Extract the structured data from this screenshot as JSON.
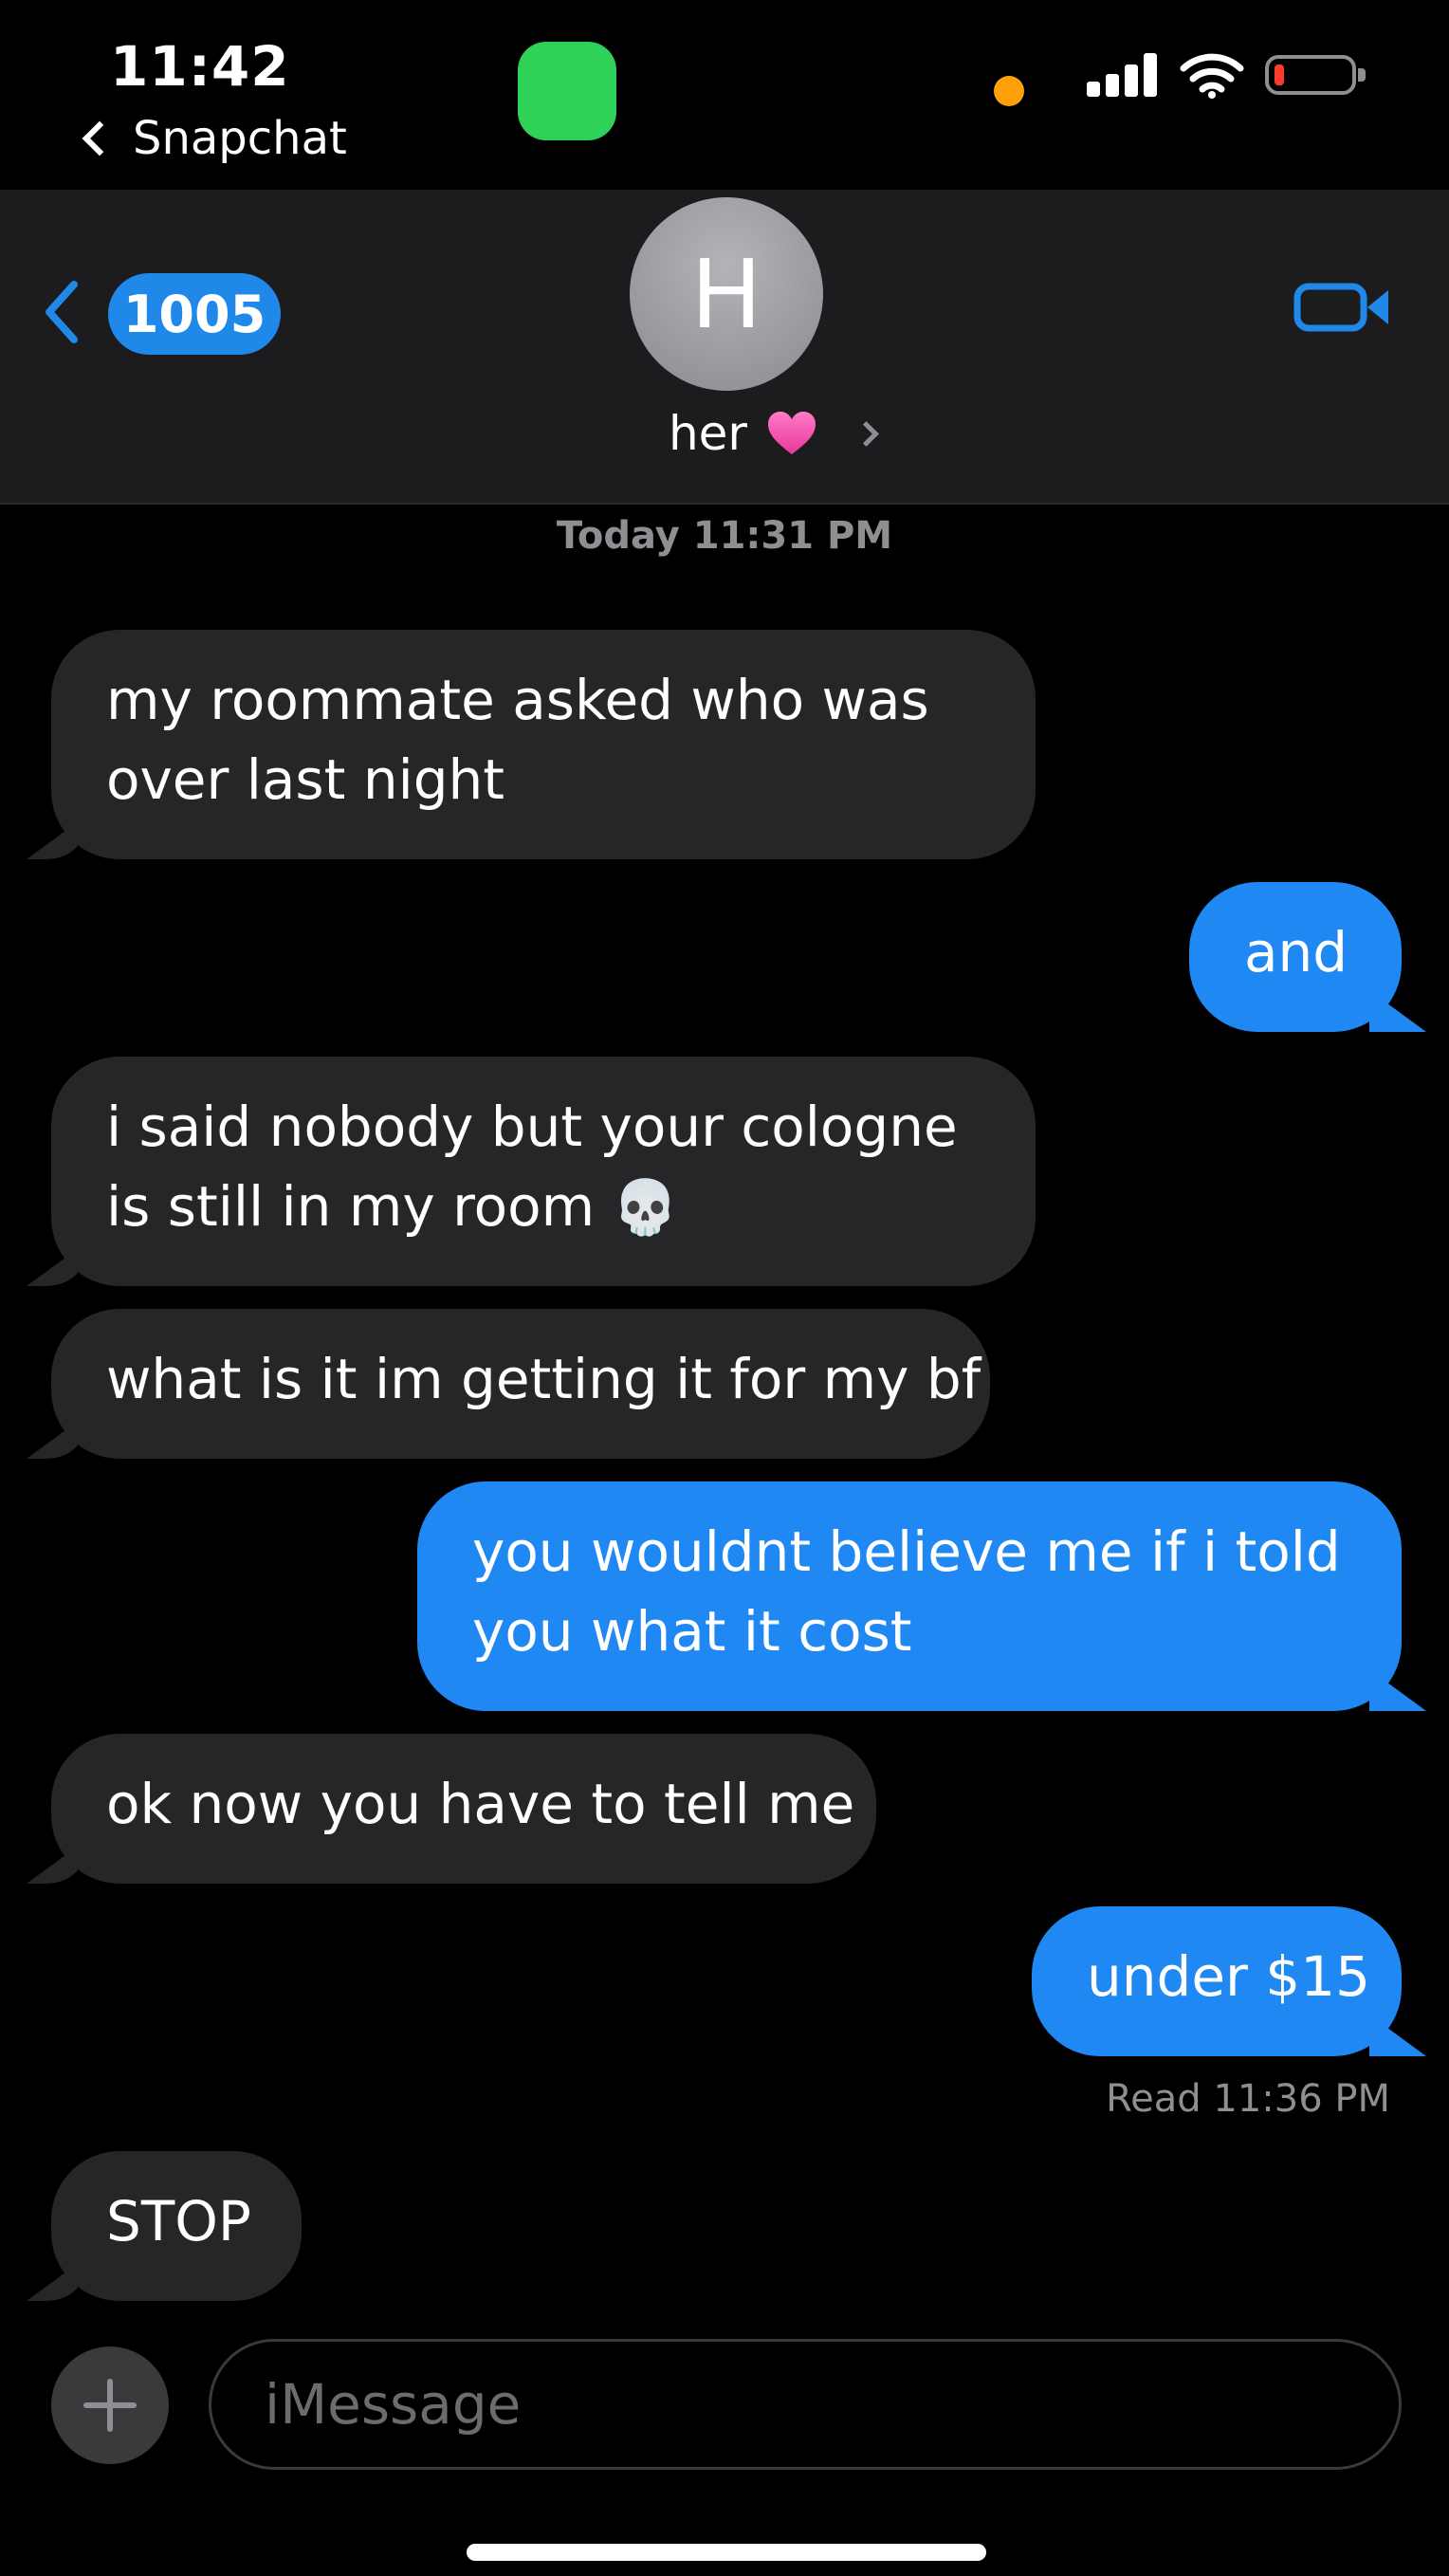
{
  "status_bar": {
    "time": "11:42",
    "back_app_label": "Snapchat",
    "signal_icon": "cellular-signal-icon",
    "wifi_icon": "wifi-icon",
    "battery_icon": "battery-low-icon",
    "recording_indicator_color": "#30d158",
    "mic_indicator_color": "#ff9f0a",
    "battery_color": "#ff3b30"
  },
  "header": {
    "unread_count": "1005",
    "avatar_initial": "H",
    "contact_name": "her",
    "contact_emoji": "pink-heart-icon",
    "video_call_icon": "facetime-video-icon",
    "accent_color": "#1f88e8"
  },
  "conversation": {
    "timestamp": "Today 11:31 PM",
    "messages": [
      {
        "direction": "incoming",
        "text_line1": "my roommate asked who was",
        "text_line2": "over last night"
      },
      {
        "direction": "outgoing",
        "text": "and"
      },
      {
        "direction": "incoming",
        "text_line1": "i said nobody but your cologne",
        "text_line2": "is still in my room",
        "emoji": "💀"
      },
      {
        "direction": "incoming",
        "text": "what is it im getting it for my bf"
      },
      {
        "direction": "outgoing",
        "text_line1": "you wouldnt believe me if i told",
        "text_line2": "you what it cost"
      },
      {
        "direction": "incoming",
        "text": "ok now you have to tell me"
      },
      {
        "direction": "outgoing",
        "text": "under $15"
      },
      {
        "direction": "incoming",
        "text": "STOP"
      }
    ],
    "read_receipt": "Read 11:36 PM"
  },
  "composer": {
    "placeholder": "iMessage",
    "add_icon": "plus-icon"
  }
}
